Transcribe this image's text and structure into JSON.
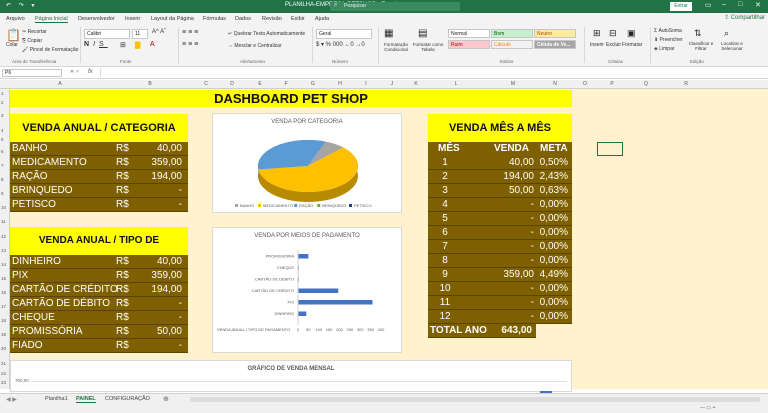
{
  "app": {
    "title": "PLANILHA-EMPRESA-PETSHOP - Excel",
    "search_placeholder": "Pesquisar",
    "signin": "Entrar",
    "share": "Compartilhar",
    "quick_access": "↶ ↷ ▾"
  },
  "menu": [
    "Arquivo",
    "Página Inicial",
    "Desenvolvedor",
    "Inserir",
    "Layout da Página",
    "Fórmulas",
    "Dados",
    "Revisão",
    "Exibir",
    "Ajuda"
  ],
  "ribbon": {
    "paste": "Colar",
    "cut": "Recortar",
    "copy": "Copiar",
    "format_painter": "Pincel de Formatação",
    "font_name": "Calibri",
    "font_size": "11",
    "wrap": "Quebrar Texto Automaticamente",
    "merge": "Mesclar e Centralizar",
    "number_format": "Geral",
    "cond_format": "Formatação Condicional",
    "format_table": "Formatar como Tabela",
    "styles": {
      "normal": "Normal",
      "bom": "Bom",
      "neutro": "Neutro",
      "ruim": "Ruim",
      "calculo": "Cálculo",
      "celula": "Célula de Ve..."
    },
    "insert": "Inserir",
    "delete": "Excluir",
    "format": "Formatar",
    "autosum": "AutoSoma",
    "fill": "Preencher",
    "clear": "Limpar",
    "sort": "Classificar e Filtrar",
    "find": "Localizar e Selecionar",
    "groups": [
      "Área de Transferência",
      "Fonte",
      "Alinhamento",
      "Número",
      "Estilos",
      "Células",
      "Edição"
    ]
  },
  "namebox": "P6",
  "fx": "fx",
  "columns": [
    "A",
    "B",
    "C",
    "D",
    "E",
    "F",
    "G",
    "H",
    "I",
    "J",
    "K",
    "L",
    "M",
    "N",
    "O",
    "P",
    "Q",
    "R"
  ],
  "rows": [
    "1",
    "2",
    "3",
    "4",
    "5",
    "6",
    "7",
    "8",
    "9",
    "10",
    "11",
    "12",
    "13",
    "14",
    "15",
    "16",
    "17",
    "18",
    "19",
    "20",
    "21",
    "22",
    "23"
  ],
  "dashboard": {
    "title": "DASHBOARD PET SHOP",
    "cat_title": "VENDA ANUAL / CATEGORIA",
    "categories": [
      {
        "name": "BANHO",
        "cur": "R$",
        "val": "40,00"
      },
      {
        "name": "MEDICAMENTO",
        "cur": "R$",
        "val": "359,00"
      },
      {
        "name": "RAÇÃO",
        "cur": "R$",
        "val": "194,00"
      },
      {
        "name": "BRINQUEDO",
        "cur": "R$",
        "val": "-"
      },
      {
        "name": "PETISCO",
        "cur": "R$",
        "val": "-"
      }
    ],
    "pay_title": "VENDA ANUAL / TIPO DE PAGAMENTO",
    "payments": [
      {
        "name": "DINHEIRO",
        "cur": "R$",
        "val": "40,00"
      },
      {
        "name": "PIX",
        "cur": "R$",
        "val": "359,00"
      },
      {
        "name": "CARTÃO DE CRÉDITO",
        "cur": "R$",
        "val": "194,00"
      },
      {
        "name": "CARTÃO DE DÉBITO",
        "cur": "R$",
        "val": "-"
      },
      {
        "name": "CHEQUE",
        "cur": "R$",
        "val": "-"
      },
      {
        "name": "PROMISSÓRIA",
        "cur": "R$",
        "val": "50,00"
      },
      {
        "name": "FIADO",
        "cur": "R$",
        "val": "-"
      }
    ],
    "month_title": "VENDA MÊS A MÊS",
    "month_headers": [
      "MÊS",
      "VENDA",
      "META"
    ],
    "months": [
      {
        "m": "1",
        "v": "40,00",
        "p": "0,50%"
      },
      {
        "m": "2",
        "v": "194,00",
        "p": "2,43%"
      },
      {
        "m": "3",
        "v": "50,00",
        "p": "0,63%"
      },
      {
        "m": "4",
        "v": "-",
        "p": "0,00%"
      },
      {
        "m": "5",
        "v": "-",
        "p": "0,00%"
      },
      {
        "m": "6",
        "v": "-",
        "p": "0,00%"
      },
      {
        "m": "7",
        "v": "-",
        "p": "0,00%"
      },
      {
        "m": "8",
        "v": "-",
        "p": "0,00%"
      },
      {
        "m": "9",
        "v": "359,00",
        "p": "4,49%"
      },
      {
        "m": "10",
        "v": "-",
        "p": "0,00%"
      },
      {
        "m": "11",
        "v": "-",
        "p": "0,00%"
      },
      {
        "m": "12",
        "v": "-",
        "p": "0,00%"
      }
    ],
    "total_label": "TOTAL ANO",
    "total_value": "643,00"
  },
  "chart_data": [
    {
      "type": "pie",
      "title": "VENDA POR CATEGORIA",
      "categories": [
        "BANHO",
        "MEDICAMENTO",
        "RAÇÃO",
        "BRINQUEDO",
        "PETISCO"
      ],
      "values": [
        40,
        359,
        194,
        0,
        0
      ],
      "colors": [
        "#a5a5a5",
        "#ffc000",
        "#5b9bd5",
        "#70ad47",
        "#264478"
      ],
      "legend": "bottom"
    },
    {
      "type": "bar",
      "orientation": "horizontal",
      "title": "VENDA POR MEIOS DE PAGAMENTO",
      "categories": [
        "PROMISSÓRIA",
        "CHEQUE",
        "CARTÃO DE DÉBITO",
        "CARTÃO DE CRÉDITO",
        "PIX",
        "DINHEIRO"
      ],
      "values": [
        50,
        0,
        0,
        194,
        359,
        40
      ],
      "xlim": [
        0,
        400
      ],
      "xticks": [
        "0",
        "50",
        "100",
        "150",
        "200",
        "250",
        "300",
        "350",
        "400"
      ],
      "xlabel": "VENDA ANUAL / TIPO DE PAGAMENTO",
      "color": "#4472c4"
    },
    {
      "type": "bar",
      "title": "GRÁFICO DE VENDA MENSAL",
      "yticks": [
        "700,00"
      ],
      "color": "#4472c4"
    }
  ],
  "sheets": [
    "Planilha1",
    "PAINEL",
    "CONFIGURAÇÃO"
  ],
  "active_sheet": "PAINEL"
}
